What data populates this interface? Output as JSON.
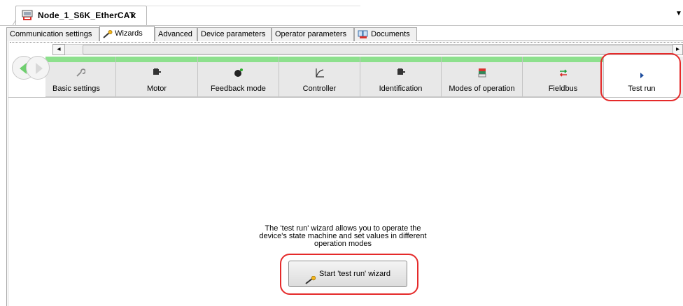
{
  "document_tab": {
    "title": "Node_1_S6K_EtherCAT",
    "close": "x",
    "icon": "device-icon"
  },
  "overflow_glyph": "▼",
  "subtabs": [
    {
      "label": "Communication settings"
    },
    {
      "label": "Wizards",
      "icon": "wand-icon",
      "active": true
    },
    {
      "label": "Advanced"
    },
    {
      "label": "Device parameters"
    },
    {
      "label": "Operator parameters"
    },
    {
      "label": "Documents",
      "icon": "documents-icon"
    }
  ],
  "scrollbar": {
    "left_arrow": "◂",
    "right_arrow": "▸"
  },
  "wizard_steps": [
    {
      "label": "Basic settings",
      "icon": "wrench-icon"
    },
    {
      "label": "Motor",
      "icon": "motor-icon"
    },
    {
      "label": "Feedback mode",
      "icon": "feedback-icon"
    },
    {
      "label": "Controller",
      "icon": "controller-icon"
    },
    {
      "label": "Identification",
      "icon": "identification-icon"
    },
    {
      "label": "Modes of operation",
      "icon": "modes-icon"
    },
    {
      "label": "Fieldbus",
      "icon": "fieldbus-icon"
    },
    {
      "label": "Test run",
      "icon": "play-icon",
      "active": true
    }
  ],
  "description": {
    "line1": "The 'test run' wizard allows you to operate the",
    "line2": "device's state machine and set values in different",
    "line3": "operation modes"
  },
  "start_button": {
    "label": "Start 'test run' wizard",
    "icon": "wand-icon"
  },
  "colors": {
    "progress_bar": "#8de08d",
    "highlight": "#e52a2a",
    "active_step_bg": "#ffffff"
  }
}
